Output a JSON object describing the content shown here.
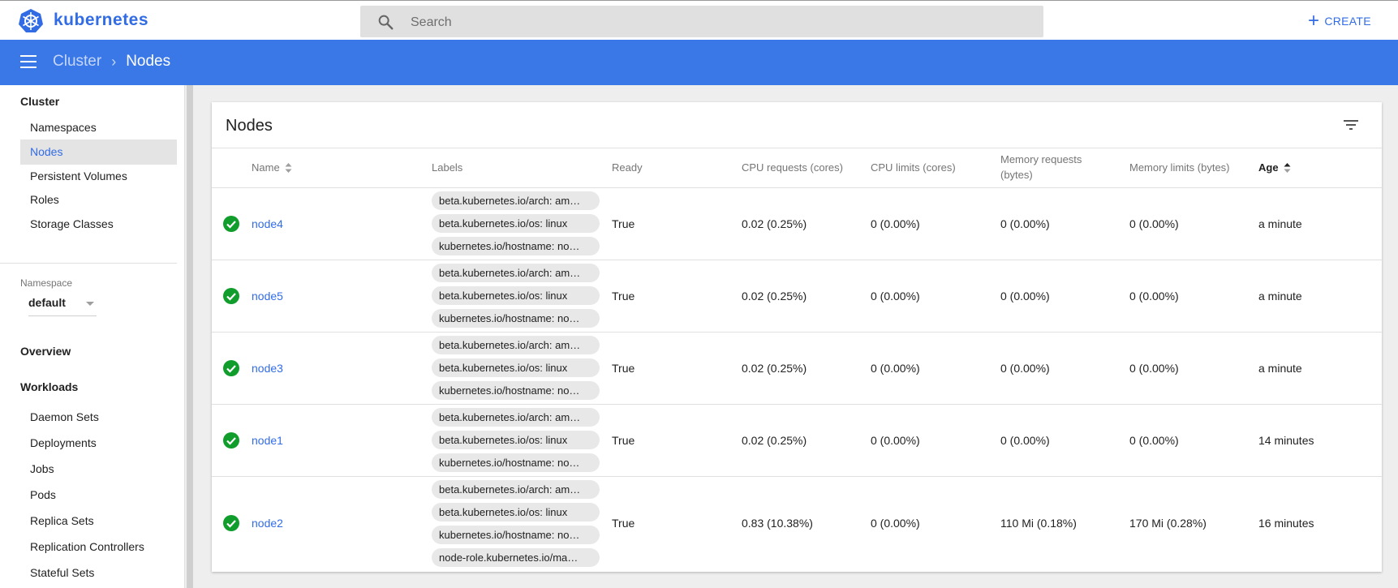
{
  "header": {
    "brand": "kubernetes",
    "search_placeholder": "Search",
    "create_label": "CREATE"
  },
  "breadcrumb": {
    "parent": "Cluster",
    "current": "Nodes"
  },
  "sidebar": {
    "cluster_heading": "Cluster",
    "cluster_items": [
      {
        "label": "Namespaces",
        "active": false
      },
      {
        "label": "Nodes",
        "active": true
      },
      {
        "label": "Persistent Volumes",
        "active": false
      },
      {
        "label": "Roles",
        "active": false
      },
      {
        "label": "Storage Classes",
        "active": false
      }
    ],
    "namespace_label": "Namespace",
    "namespace_value": "default",
    "overview": "Overview",
    "workloads_heading": "Workloads",
    "workload_items": [
      {
        "label": "Daemon Sets"
      },
      {
        "label": "Deployments"
      },
      {
        "label": "Jobs"
      },
      {
        "label": "Pods"
      },
      {
        "label": "Replica Sets"
      },
      {
        "label": "Replication Controllers"
      },
      {
        "label": "Stateful Sets"
      }
    ]
  },
  "nodes": {
    "title": "Nodes",
    "columns": {
      "name": "Name",
      "labels": "Labels",
      "ready": "Ready",
      "cpu_requests": "CPU requests (cores)",
      "cpu_limits": "CPU limits (cores)",
      "mem_requests_1": "Memory requests",
      "mem_requests_2": "(bytes)",
      "mem_limits": "Memory limits (bytes)",
      "age": "Age"
    },
    "rows": [
      {
        "name": "node4",
        "labels": [
          "beta.kubernetes.io/arch: am…",
          "beta.kubernetes.io/os: linux",
          "kubernetes.io/hostname: no…"
        ],
        "ready": "True",
        "cpu_requests": "0.02 (0.25%)",
        "cpu_limits": "0 (0.00%)",
        "mem_requests": "0 (0.00%)",
        "mem_limits": "0 (0.00%)",
        "age": "a minute"
      },
      {
        "name": "node5",
        "labels": [
          "beta.kubernetes.io/arch: am…",
          "beta.kubernetes.io/os: linux",
          "kubernetes.io/hostname: no…"
        ],
        "ready": "True",
        "cpu_requests": "0.02 (0.25%)",
        "cpu_limits": "0 (0.00%)",
        "mem_requests": "0 (0.00%)",
        "mem_limits": "0 (0.00%)",
        "age": "a minute"
      },
      {
        "name": "node3",
        "labels": [
          "beta.kubernetes.io/arch: am…",
          "beta.kubernetes.io/os: linux",
          "kubernetes.io/hostname: no…"
        ],
        "ready": "True",
        "cpu_requests": "0.02 (0.25%)",
        "cpu_limits": "0 (0.00%)",
        "mem_requests": "0 (0.00%)",
        "mem_limits": "0 (0.00%)",
        "age": "a minute"
      },
      {
        "name": "node1",
        "labels": [
          "beta.kubernetes.io/arch: am…",
          "beta.kubernetes.io/os: linux",
          "kubernetes.io/hostname: no…"
        ],
        "ready": "True",
        "cpu_requests": "0.02 (0.25%)",
        "cpu_limits": "0 (0.00%)",
        "mem_requests": "0 (0.00%)",
        "mem_limits": "0 (0.00%)",
        "age": "14 minutes"
      },
      {
        "name": "node2",
        "labels": [
          "beta.kubernetes.io/arch: am…",
          "beta.kubernetes.io/os: linux",
          "kubernetes.io/hostname: no…",
          "node-role.kubernetes.io/ma…"
        ],
        "ready": "True",
        "cpu_requests": "0.83 (10.38%)",
        "cpu_limits": "0 (0.00%)",
        "mem_requests": "110 Mi (0.18%)",
        "mem_limits": "170 Mi (0.28%)",
        "age": "16 minutes"
      }
    ]
  },
  "icons": {
    "logo": "kubernetes-wheel-icon",
    "search": "search-icon",
    "create": "plus-icon",
    "menu": "hamburger-menu-icon",
    "filter": "filter-icon",
    "status": "check-circle-icon",
    "sort": "sort-icon"
  },
  "colors": {
    "brand": "#326ce5",
    "navbar": "#3a78e8",
    "status_ok": "#109d2b"
  }
}
